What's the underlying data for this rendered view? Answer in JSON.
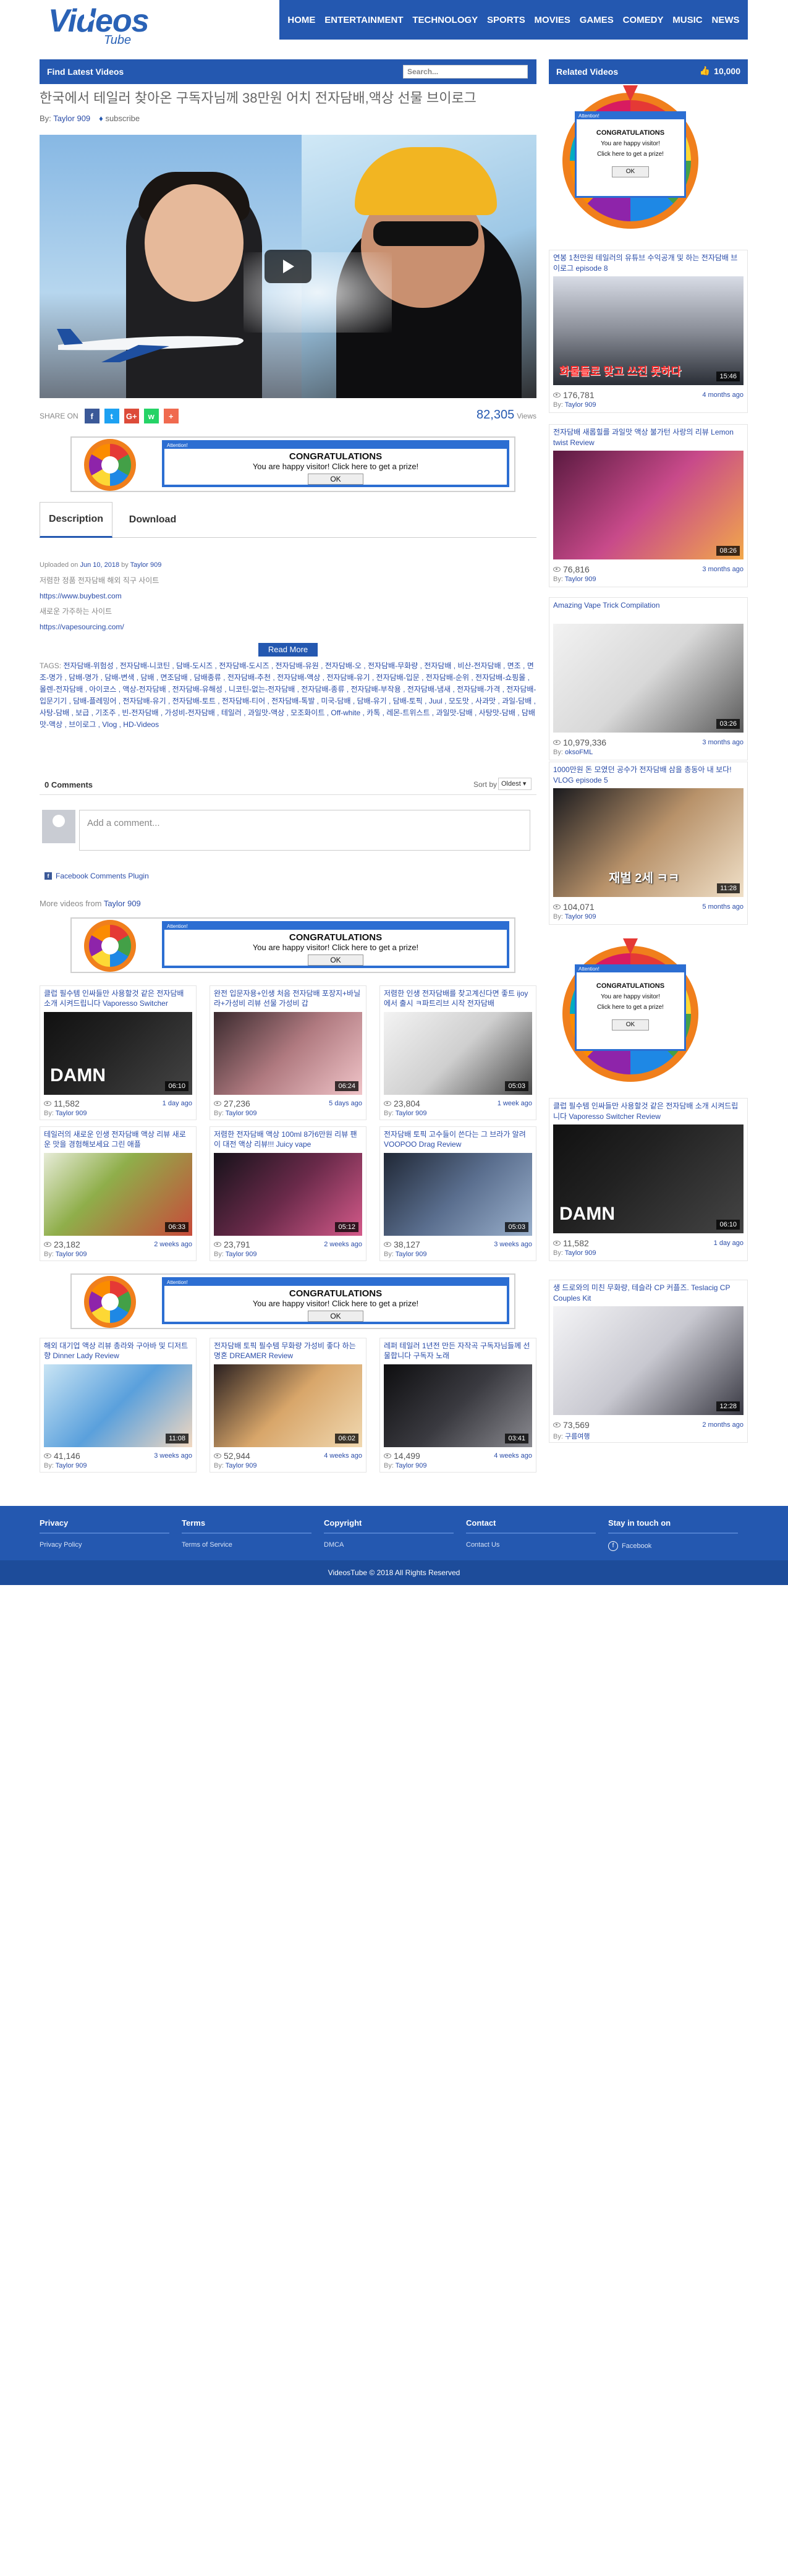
{
  "header": {
    "logo_main": "Videos",
    "logo_sub": "Tube",
    "nav": [
      "HOME",
      "ENTERTAINMENT",
      "TECHNOLOGY",
      "SPORTS",
      "MOVIES",
      "GAMES",
      "COMEDY",
      "MUSIC",
      "NEWS"
    ]
  },
  "find_bar": {
    "label": "Find Latest Videos",
    "search_placeholder": "Search..."
  },
  "related_bar": {
    "label": "Related Videos",
    "subscribers": "10,000"
  },
  "video": {
    "title": "한국에서 테일러 찾아온 구독자님께 38만원 어치 전자담배,액상 선물 브이로그",
    "by_label": "By:",
    "author": "Taylor 909",
    "subscribe": "subscribe",
    "share_label": "SHARE ON",
    "views": "82,305",
    "views_label": "Views"
  },
  "share_buttons": [
    {
      "name": "facebook",
      "glyph": "f",
      "color": "#3b5998"
    },
    {
      "name": "twitter",
      "glyph": "t",
      "color": "#1da1f2"
    },
    {
      "name": "google-plus",
      "glyph": "G+",
      "color": "#dd4b39"
    },
    {
      "name": "whatsapp",
      "glyph": "w",
      "color": "#25d366"
    },
    {
      "name": "more",
      "glyph": "+",
      "color": "#f06a4f"
    }
  ],
  "ad": {
    "top_label": "Attention!",
    "title": "CONGRATULATIONS",
    "text": "You are happy visitor!  Click here to get a prize!",
    "ok": "OK"
  },
  "side_ad": {
    "top_label": "Attention!",
    "title": "CONGRATULATIONS",
    "text1": "You are happy visitor!",
    "text2": "Click here to get a prize!",
    "ok": "OK"
  },
  "tabs": [
    "Description",
    "Download"
  ],
  "description": {
    "uploaded_prefix": "Uploaded on",
    "uploaded_date": "Jun 10, 2018",
    "uploaded_by": "by",
    "uploader": "Taylor 909",
    "line1": "저렴한 정품 전자담배 해외 직구 사이트",
    "link1": "https://www.buybest.com",
    "line2": "새로운 가주하는 사이트",
    "link2": "https://vapesourcing.com/",
    "read_more": "Read More"
  },
  "tags": {
    "label": "TAGS:",
    "text": "전자담배-위험성 , 전자담배-니코틴 , 담배-도시즈 , 전자담배-도시즈 , 전자담배-유원 , 전자담배-오 , 전자담배-무화량 , 전자담배 , 비산-전자담배 , 면조 , 면조-명가 , 담배-명가 , 담배-변색 , 담배 , 면조담배 , 담배종류 , 전자담배-추천 , 전자담배-액상 , 전자담배-유기 , 전자담배-입문 , 전자담배-순위 , 전자담배-쇼핑몰 , 몰렌-전자담배 , 아이코스 , 액상-전자담배 , 전자담배-유해성 , 니코틴-없는-전자담배 , 전자담배-종류 , 전자담배-부작용 , 전자담배-냄새 , 전자담배-가격 , 전자담배-입문기기 , 담배-플레밍어 , 전자담배-유기 , 전자담배-토트 , 전자담배-티어 , 전자담배-톡발 , 미국-담배 , 담배-유기 , 담배-토픽 , Juul , 모도맛 , 사과맛 , 과일-담배 , 사탕-담배 , 보급 , 기조주 , 빈-전자담배 , 가성비-전자담배 , 테일러 , 과일맛-액상 , 모조화이트 , Off-white , 카톡 , 레몬-트위스트 , 과일맛-담배 , 사탕맛-담배 , 담배맛-액상 , 브이로그 , Vlog , HD-Videos"
  },
  "comments": {
    "count": "0 Comments",
    "sort_label": "Sort by",
    "sort_value": "Oldest",
    "placeholder": "Add a comment...",
    "plugin": "Facebook Comments Plugin"
  },
  "more_from": {
    "prefix": "More videos from",
    "author": "Taylor 909"
  },
  "main_cards": [
    {
      "title": "클럽 필수템 인싸들만 사용할것 같은 전자담배 소개 시켜드립니다 Vaporesso Switcher Review",
      "dur": "06:10",
      "views": "11,582",
      "age": "1 day ago",
      "by": "Taylor 909",
      "thumb": "a"
    },
    {
      "title": "완전 입문자용+인생 처음 전자담배 포장지+바닐라+가성비 리뷰 선물 가성비 갑",
      "dur": "06:24",
      "views": "27,236",
      "age": "5 days ago",
      "by": "Taylor 909",
      "thumb": "b"
    },
    {
      "title": "저렴한 인생 전자담배를 찾고계신다면 좋트 ijoy에서 출시 ㅋ파트리브 시작 전자담배",
      "dur": "05:03",
      "views": "23,804",
      "age": "1 week ago",
      "by": "Taylor 909",
      "thumb": "c"
    },
    {
      "title": "테일러의 새로운 인생 전자담배 액상 리뷰 새로운 맛을 경험해보세요 그린 애플",
      "dur": "06:33",
      "views": "23,182",
      "age": "2 weeks ago",
      "by": "Taylor 909",
      "thumb": "d"
    },
    {
      "title": "저렴한 전자담배 액상 100ml 8가6만원 리뷰 팬이 대전 액상 리뷰!!! Juicy vape",
      "dur": "05:12",
      "views": "23,791",
      "age": "2 weeks ago",
      "by": "Taylor 909",
      "thumb": "e"
    },
    {
      "title": "전자담배 토픽 고수들이 쓴다는 그 브라가 알려 VOOPOO Drag Review",
      "dur": "05:03",
      "views": "38,127",
      "age": "3 weeks ago",
      "by": "Taylor 909",
      "thumb": "f"
    },
    {
      "title": "해외 대기업 액상 리뷰 총라와 구아바 및 디저트 향 Dinner Lady Review",
      "dur": "11:08",
      "views": "41,146",
      "age": "3 weeks ago",
      "by": "Taylor 909",
      "thumb": "g"
    },
    {
      "title": "전자담배 토픽 필수템 무화량 가성비 좋다 하는 명혼 DREAMER Review",
      "dur": "06:02",
      "views": "52,944",
      "age": "4 weeks ago",
      "by": "Taylor 909",
      "thumb": "h"
    },
    {
      "title": "레퍼 테일러 1년전 만든 자작곡 구독자님들께 선물합니다 구독자 노래",
      "dur": "03:41",
      "views": "14,499",
      "age": "4 weeks ago",
      "by": "Taylor 909",
      "thumb": "i"
    }
  ],
  "side_cards": [
    {
      "title": "연봉 1천만원 테일러의 유튜브 수익공개 및 하는 전자담배 브이로그 episode 8",
      "dur": "15:46",
      "views": "176,781",
      "age": "4 months ago",
      "by": "Taylor 909",
      "thumb": "s1"
    },
    {
      "title": "전자담배 새롭힐를 과일맛 액상 불가턴 사랑의 리뷰 Lemon twist Review",
      "dur": "08:26",
      "views": "76,816",
      "age": "3 months ago",
      "by": "Taylor 909",
      "thumb": "s2"
    },
    {
      "title": "Amazing Vape Trick Compilation",
      "dur": "03:26",
      "views": "10,979,336",
      "age": "3 months ago",
      "by": "oksoFML",
      "thumb": "s3"
    },
    {
      "title": "1000만원 돈 모였던 공수가 전자담배 삼을 총동아 내 보다! VLOG episode 5",
      "dur": "11:28",
      "views": "104,071",
      "age": "5 months ago",
      "by": "Taylor 909",
      "thumb": "s4"
    },
    {
      "title": "클럽 필수템 인싸들만 사용할것 같은 전자담배 소개 시켜드립니다 Vaporesso Switcher Review",
      "dur": "06:10",
      "views": "11,582",
      "age": "1 day ago",
      "by": "Taylor 909",
      "thumb": "a"
    },
    {
      "title": "생 드로와의 미친 무화량, 테슬라 CP 커플즈. Teslacig CP Couples Kit",
      "dur": "12:28",
      "views": "73,569",
      "age": "2 months ago",
      "by": "구름여행",
      "thumb": "s6"
    }
  ],
  "thumb_texts": {
    "damn": "DAMN",
    "s1_overlay": "화물들로 맞고 쓰진 못하다",
    "s4_overlay": "재벌 2세 ㅋㅋ"
  },
  "footer": {
    "cols": [
      {
        "head": "Privacy",
        "link": "Privacy Policy"
      },
      {
        "head": "Terms",
        "link": "Terms of Service"
      },
      {
        "head": "Copyright",
        "link": "DMCA"
      },
      {
        "head": "Contact",
        "link": "Contact Us"
      },
      {
        "head": "Stay in touch on",
        "link": "Facebook"
      }
    ],
    "copyright": "VideosTube © 2018 All Rights Reserved"
  }
}
